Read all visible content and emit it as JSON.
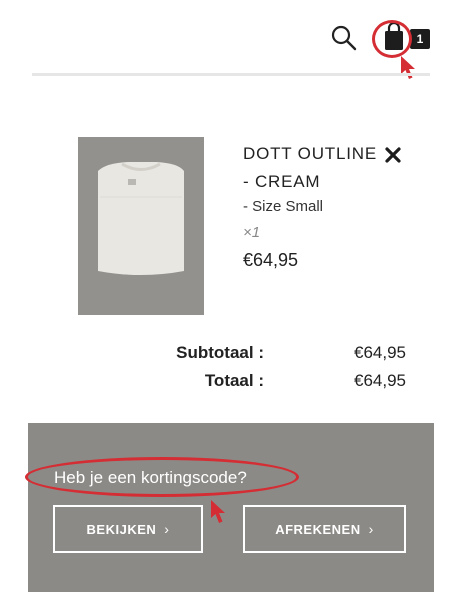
{
  "header": {
    "cart_count": "1"
  },
  "product": {
    "name_line1": "DOTT OUTLINE",
    "name_line2": "- CREAM",
    "size": "- Size Small",
    "quantity": "×1",
    "price": "€64,95"
  },
  "totals": {
    "subtotal_label": "Subtotaal :",
    "subtotal_value": "€64,95",
    "total_label": "Totaal :",
    "total_value": "€64,95"
  },
  "checkout": {
    "discount_prompt": "Heb je een kortingscode?",
    "view_cart_label": "BEKIJKEN",
    "checkout_label": "AFREKENEN"
  },
  "icons": {
    "search": "search-icon",
    "cart": "shopping-bag-icon",
    "remove": "close-icon",
    "chevron": "chevron-right-icon"
  },
  "colors": {
    "panel": "#8c8a86",
    "annotation": "#d42d34"
  }
}
